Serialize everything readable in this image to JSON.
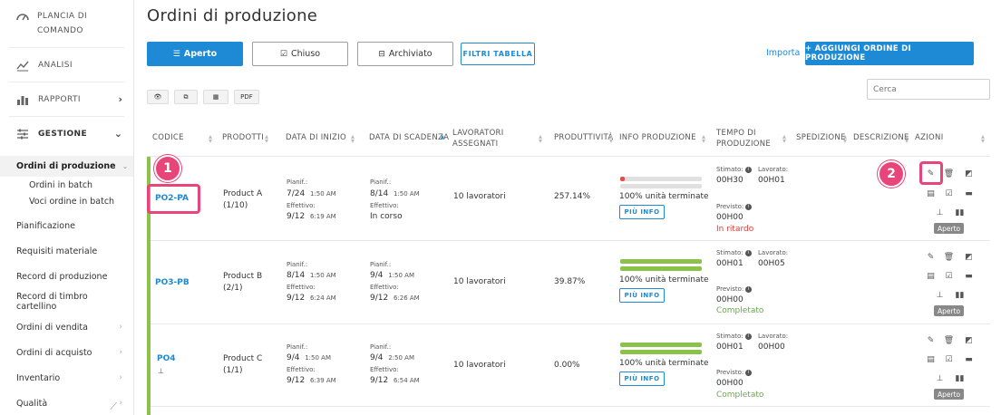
{
  "sidebar": {
    "top": {
      "label_line1": "PLANCIA DI",
      "label_line2": "COMANDO",
      "icon": "dashboard-icon"
    },
    "analisi": "ANALISI",
    "rapporti": "RAPPORTI",
    "gestione": "GESTIONE",
    "active": "Ordini di produzione",
    "subitems": [
      "Ordini in batch",
      "Voci ordine in batch"
    ],
    "items": [
      {
        "label": "Pianificazione",
        "chev": ""
      },
      {
        "label": "Requisiti materiale",
        "chev": ""
      },
      {
        "label": "Record di produzione",
        "chev": ""
      },
      {
        "label": "Record di timbro cartellino",
        "chev": ""
      },
      {
        "label": "Ordini di vendita",
        "chev": "›"
      },
      {
        "label": "Ordini di acquisto",
        "chev": "›"
      },
      {
        "label": "Inventario",
        "chev": "›"
      },
      {
        "label": "Qualità",
        "chev": "›"
      }
    ]
  },
  "page": {
    "title": "Ordini di produzione"
  },
  "tabs": {
    "aperto": "Aperto",
    "chiuso": "Chiuso",
    "archiviato": "Archiviato"
  },
  "filter_button": "FILTRI TABELLA",
  "importa": "Importa",
  "add_button": "+ AGGIUNGI ORDINE DI PRODUZIONE",
  "tools": {
    "pdf": "PDF"
  },
  "search": {
    "placeholder": "Cerca"
  },
  "columns": {
    "codice": "CODICE",
    "prodotti": "PRODOTTI",
    "data_inizio": "DATA DI INIZIO",
    "data_scadenza": "DATA DI SCADENZA",
    "lavoratori_1": "LAVORATORI",
    "lavoratori_2": "ASSEGNATI",
    "produttivita": "PRODUTTIVITÀ",
    "info": "INFO PRODUZIONE",
    "tempo_1": "TEMPO DI",
    "tempo_2": "PRODUZIONE",
    "spedizione": "SPEDIZIONE",
    "descrizione": "DESCRIZIONE",
    "azioni": "AZIONI"
  },
  "labels": {
    "planned": "Pianif.:",
    "actual": "Effettivo:",
    "estimated": "Stimato:",
    "worked": "Lavorato:",
    "expected": "Previsto:",
    "more_info": "PIÙ INFO",
    "units_done": "100% unità terminate"
  },
  "rows": [
    {
      "code": "PO2-PA",
      "product": "Product A",
      "qty": "(1/10)",
      "start_planned_date": "7/24",
      "start_planned_time": "1:50 AM",
      "start_actual_date": "9/12",
      "start_actual_time": "6:19 AM",
      "due_planned_date": "8/14",
      "due_planned_time": "1:50 AM",
      "due_actual": "In corso",
      "workers": "10 lavoratori",
      "productivity": "257.14%",
      "progress": 0.06,
      "est": "00H30",
      "worked": "00H01",
      "expected": "00H00",
      "status": "In ritardo",
      "badge": "Aperto"
    },
    {
      "code": "PO3-PB",
      "product": "Product B",
      "qty": "(2/1)",
      "start_planned_date": "8/14",
      "start_planned_time": "1:50 AM",
      "start_actual_date": "9/12",
      "start_actual_time": "6:24 AM",
      "due_planned_date": "9/4",
      "due_planned_time": "1:50 AM",
      "due_actual_date": "9/12",
      "due_actual_time": "6:26 AM",
      "workers": "10 lavoratori",
      "productivity": "39.87%",
      "progress": 1.0,
      "est": "00H01",
      "worked": "00H05",
      "expected": "00H00",
      "status": "Completato",
      "badge": "Aperto"
    },
    {
      "code": "PO4",
      "product": "Product C",
      "qty": "(1/1)",
      "start_planned_date": "9/4",
      "start_planned_time": "1:50 AM",
      "start_actual_date": "9/12",
      "start_actual_time": "6:39 AM",
      "due_planned_date": "9/4",
      "due_planned_time": "2:50 AM",
      "due_actual_date": "9/12",
      "due_actual_time": "6:54 AM",
      "workers": "10 lavoratori",
      "productivity": "0.00%",
      "progress": 1.0,
      "est": "00H01",
      "worked": "00H00",
      "expected": "00H00",
      "status": "Completato",
      "badge": "Aperto"
    }
  ],
  "callouts": [
    "1",
    "2"
  ]
}
